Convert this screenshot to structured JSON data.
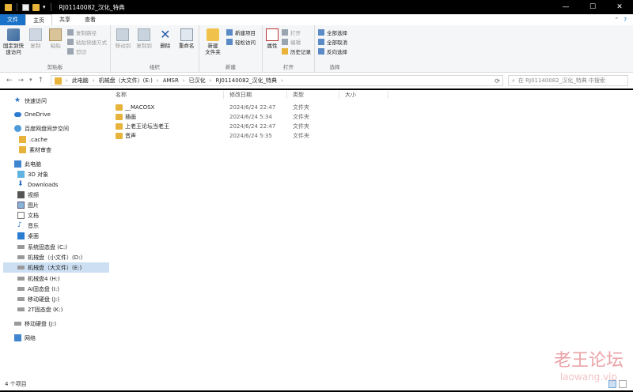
{
  "window": {
    "title": "RJ01140082_汉化_特典",
    "minimize": "—",
    "maximize": "☐",
    "close": "✕"
  },
  "tabs": [
    {
      "label": "文件"
    },
    {
      "label": "主页"
    },
    {
      "label": "共享"
    },
    {
      "label": "查看"
    }
  ],
  "ribbon": {
    "clipboard": {
      "label": "剪贴板",
      "pin": "固定到快\n速访问",
      "copy": "复制",
      "paste": "粘贴",
      "copy_path": "复制路径",
      "paste_shortcut": "粘贴快捷方式",
      "cut": "剪切"
    },
    "organize": {
      "label": "组织",
      "move_to": "移动到",
      "copy_to": "复制到",
      "delete": "删除",
      "rename": "重命名"
    },
    "new": {
      "label": "新建",
      "new_folder": "新建\n文件夹",
      "new_item": "新建项目",
      "easy_access": "轻松访问"
    },
    "open": {
      "label": "打开",
      "properties": "属性",
      "open": "打开",
      "edit": "编辑",
      "history": "历史记录"
    },
    "select": {
      "label": "选择",
      "select_all": "全部选择",
      "select_none": "全部取消",
      "invert": "反向选择"
    }
  },
  "address": {
    "crumbs": [
      "此电脑",
      "机械盘（大文件）(E:)",
      "AMSR",
      "已汉化",
      "RJ01140082_汉化_特典"
    ],
    "search_placeholder": "在 RJ01140082_汉化_特典 中搜索"
  },
  "sidebar": {
    "items": [
      {
        "label": "快速访问",
        "icon": "star-icon"
      },
      {
        "label": "OneDrive",
        "icon": "cloud-icon"
      },
      {
        "label": "百度网盘同步空间",
        "icon": "sync-icon"
      },
      {
        "label": ".cache",
        "icon": "folder-icon"
      },
      {
        "label": "素材审查",
        "icon": "folder-icon"
      },
      {
        "label": "此电脑",
        "icon": "computer-icon"
      },
      {
        "label": "3D 对象",
        "icon": "cube-icon"
      },
      {
        "label": "Downloads",
        "icon": "download-icon"
      },
      {
        "label": "视频",
        "icon": "video-icon"
      },
      {
        "label": "图片",
        "icon": "picture-icon"
      },
      {
        "label": "文档",
        "icon": "document-icon"
      },
      {
        "label": "音乐",
        "icon": "music-icon"
      },
      {
        "label": "桌面",
        "icon": "desktop-icon"
      },
      {
        "label": "系统固态盘 (C:)",
        "icon": "drive-icon"
      },
      {
        "label": "机械盘（小文件）(D:)",
        "icon": "drive-icon"
      },
      {
        "label": "机械盘（大文件）(E:)",
        "icon": "drive-icon"
      },
      {
        "label": "机械盘4 (H:)",
        "icon": "drive-icon"
      },
      {
        "label": "AI固态盘 (I:)",
        "icon": "drive-icon"
      },
      {
        "label": "移动硬盘 (J:)",
        "icon": "drive-icon"
      },
      {
        "label": "2T固态盘 (K:)",
        "icon": "drive-icon"
      },
      {
        "label": "移动硬盘 (J:)",
        "icon": "drive-icon"
      },
      {
        "label": "网络",
        "icon": "network-icon"
      }
    ]
  },
  "columns": {
    "name": "名称",
    "date": "修改日期",
    "type": "类型",
    "size": "大小"
  },
  "files": [
    {
      "name": "__MACOSX",
      "date": "2024/6/24 22:47",
      "type": "文件夹"
    },
    {
      "name": "插画",
      "date": "2024/6/24 5:34",
      "type": "文件夹"
    },
    {
      "name": "上老王论坛当老王",
      "date": "2024/6/24 22:47",
      "type": "文件夹"
    },
    {
      "name": "音声",
      "date": "2024/6/24 5:35",
      "type": "文件夹"
    }
  ],
  "status": {
    "count": "4 个项目"
  },
  "watermark": {
    "cn": "老王论坛",
    "en": "laowang.vip"
  }
}
